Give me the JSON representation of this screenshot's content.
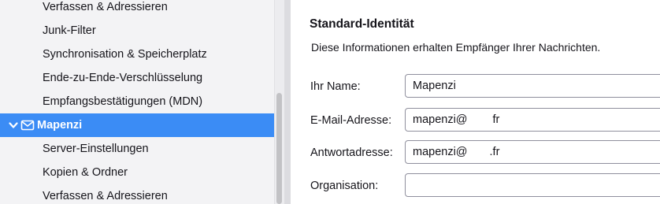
{
  "sidebar": {
    "items": [
      {
        "label": "Verfassen & Adressieren"
      },
      {
        "label": "Junk-Filter"
      },
      {
        "label": "Synchronisation & Speicherplatz"
      },
      {
        "label": "Ende-zu-Ende-Verschlüsselung"
      },
      {
        "label": "Empfangsbestätigungen (MDN)"
      },
      {
        "label": "Mapenzi"
      },
      {
        "label": "Server-Einstellungen"
      },
      {
        "label": "Kopien & Ordner"
      },
      {
        "label": "Verfassen & Adressieren"
      }
    ]
  },
  "identity": {
    "title": "Standard-Identität",
    "description": "Diese Informationen erhalten Empfänger Ihrer Nachrichten.",
    "fields": [
      {
        "label": "Ihr Name:",
        "value": "Mapenzi"
      },
      {
        "label": "E-Mail-Adresse:",
        "value_prefix": "mapenzi@",
        "value_suffix": "fr"
      },
      {
        "label": "Antwortadresse:",
        "value_prefix": "mapenzi@",
        "value_suffix": ".fr"
      },
      {
        "label": "Organisation:",
        "value": ""
      }
    ]
  },
  "colors": {
    "selection": "#3b8cf5",
    "sidebar_bg": "#f3f3f5"
  }
}
